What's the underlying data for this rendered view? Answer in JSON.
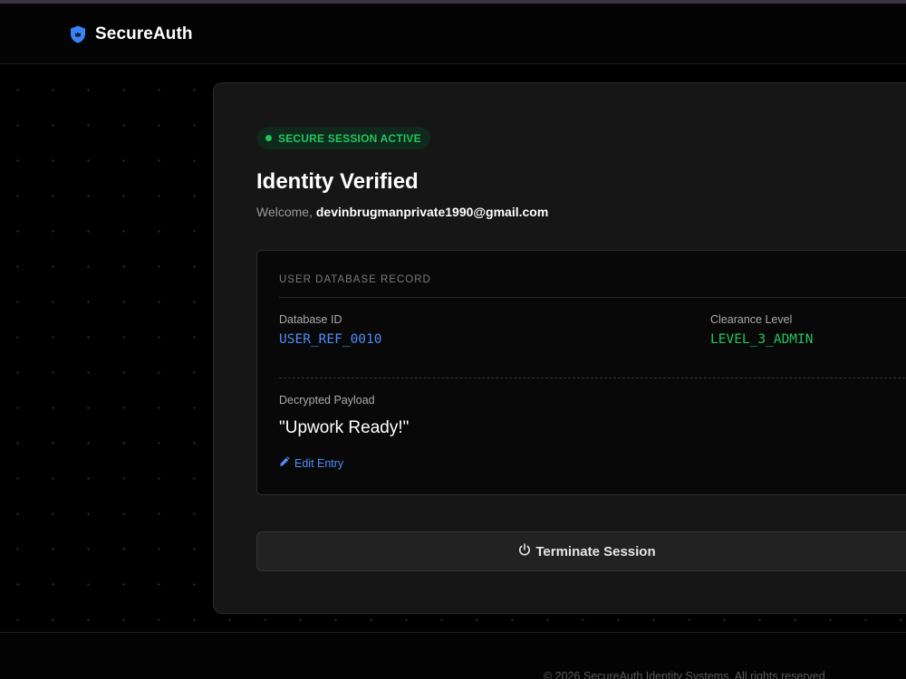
{
  "header": {
    "brand": "SecureAuth",
    "brand_icon": "shield-icon",
    "accent_color": "#3b82f6"
  },
  "session": {
    "badge": "SECURE SESSION ACTIVE",
    "badge_color": "#22c55e",
    "title": "Identity Verified",
    "welcome_prefix": "Welcome,",
    "email": "devinbrugmanprivate1990@gmail.com"
  },
  "record": {
    "section_label": "USER DATABASE RECORD",
    "database_id_label": "Database ID",
    "database_id": "USER_REF_0010",
    "clearance_label": "Clearance Level",
    "clearance": "LEVEL_3_ADMIN",
    "payload_label": "Decrypted Payload",
    "payload": "\"Upwork Ready!\"",
    "edit_label": "Edit Entry",
    "edit_icon": "pencil-icon"
  },
  "actions": {
    "terminate_label": "Terminate Session",
    "terminate_icon": "power-icon"
  },
  "footer": {
    "copyright": "© 2026 SecureAuth Identity Systems. All rights reserved."
  }
}
